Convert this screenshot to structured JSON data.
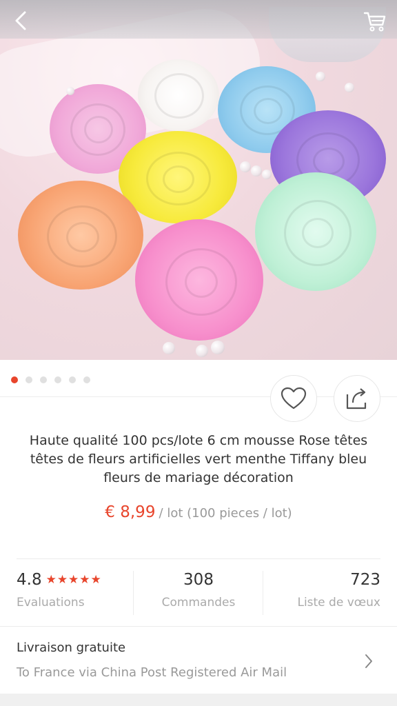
{
  "topbar": {
    "back_icon": "chevron-left-icon",
    "cart_icon": "cart-icon"
  },
  "gallery": {
    "image_count": 6,
    "active_index": 0
  },
  "actions": {
    "favorite_icon": "heart-icon",
    "share_icon": "share-icon"
  },
  "product": {
    "title": "Haute qualité 100 pcs/lote 6 cm mousse Rose têtes têtes de fleurs artificielles vert menthe Tiffany bleu fleurs de mariage décoration",
    "price": "€ 8,99",
    "unit": "/ lot (100 pieces / lot)"
  },
  "stats": {
    "rating": "4.8",
    "stars": "★★★★★",
    "rating_label": "Evaluations",
    "orders": "308",
    "orders_label": "Commandes",
    "wishlist": "723",
    "wishlist_label": "Liste de vœux"
  },
  "shipping": {
    "title": "Livraison gratuite",
    "detail": "To France via China Post Registered Air Mail"
  },
  "colors": {
    "accent": "#e8452c"
  }
}
